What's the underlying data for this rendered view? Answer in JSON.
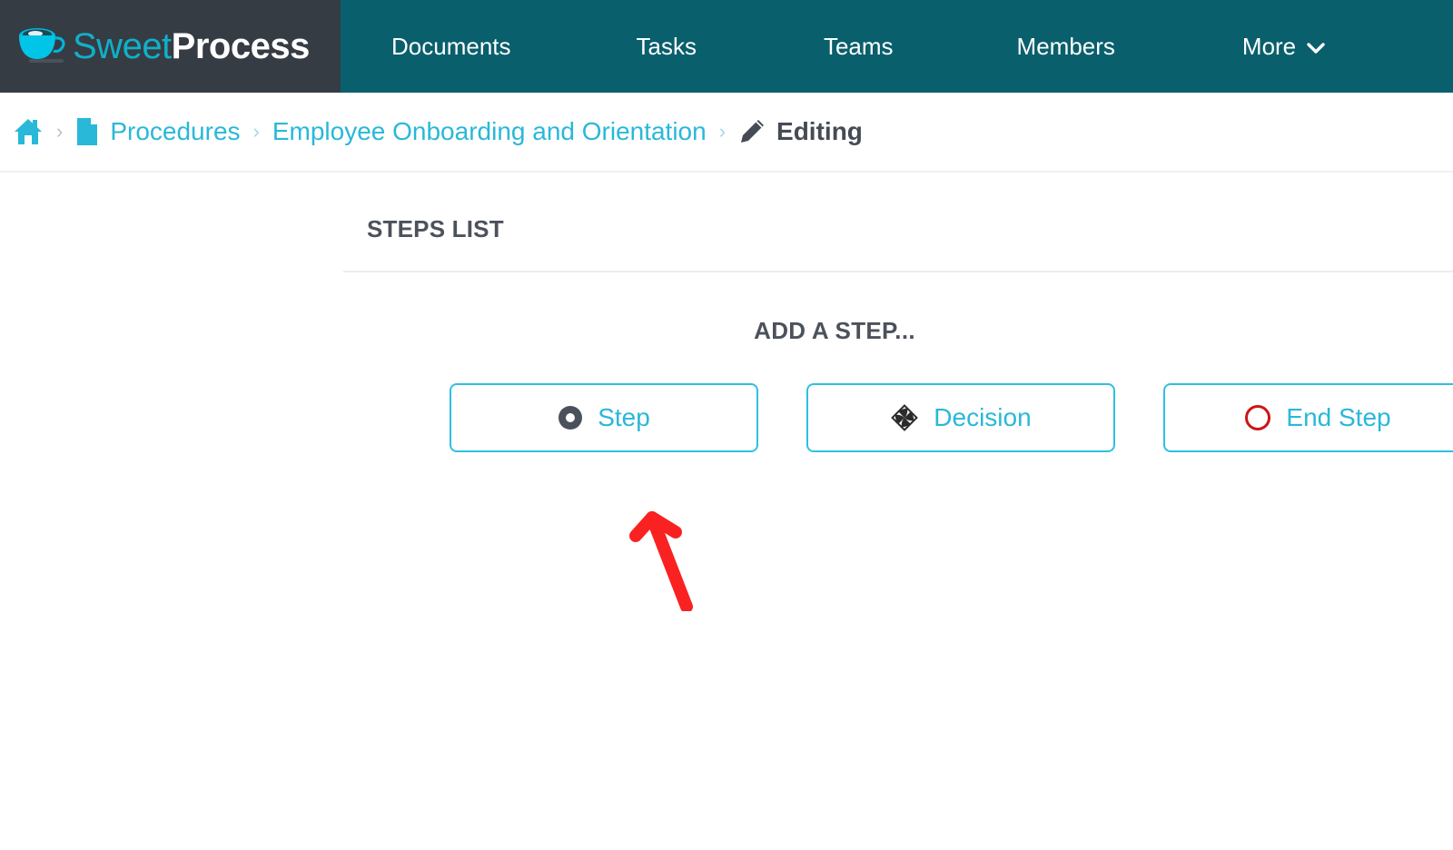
{
  "brand": {
    "name_part1": "Sweet",
    "name_part2": "Process",
    "logo_icon": "coffee-cup-icon"
  },
  "topnav": {
    "items": [
      {
        "label": "Documents",
        "icon": ""
      },
      {
        "label": "Tasks",
        "icon": ""
      },
      {
        "label": "Teams",
        "icon": ""
      },
      {
        "label": "Members",
        "icon": ""
      },
      {
        "label": "More",
        "icon": "chevron-down-icon"
      }
    ]
  },
  "breadcrumb": {
    "home_icon": "home-icon",
    "separator": "›",
    "items": [
      {
        "label": "Procedures",
        "icon": "document-icon",
        "is_current": false
      },
      {
        "label": "Employee Onboarding and Orientation",
        "icon": "",
        "is_current": false
      },
      {
        "label": "Editing",
        "icon": "pencil-icon",
        "is_current": true
      }
    ]
  },
  "main": {
    "section_title": "STEPS LIST",
    "add_step_label": "ADD A STEP...",
    "step_buttons": [
      {
        "label": "Step",
        "icon": "filled-dot-icon"
      },
      {
        "label": "Decision",
        "icon": "diamond-decision-icon"
      },
      {
        "label": "End Step",
        "icon": "red-circle-icon"
      }
    ]
  },
  "annotation": {
    "type": "arrow",
    "color": "#fa2121",
    "points_to": "Step"
  },
  "colors": {
    "brand_dark": "#363c44",
    "nav_teal": "#0a5f6c",
    "accent_cyan": "#29b8d8",
    "border_cyan": "#2fc0e0",
    "text_dark": "#4c525c",
    "annotation_red": "#fa2121",
    "end_step_red": "#cc1616"
  }
}
